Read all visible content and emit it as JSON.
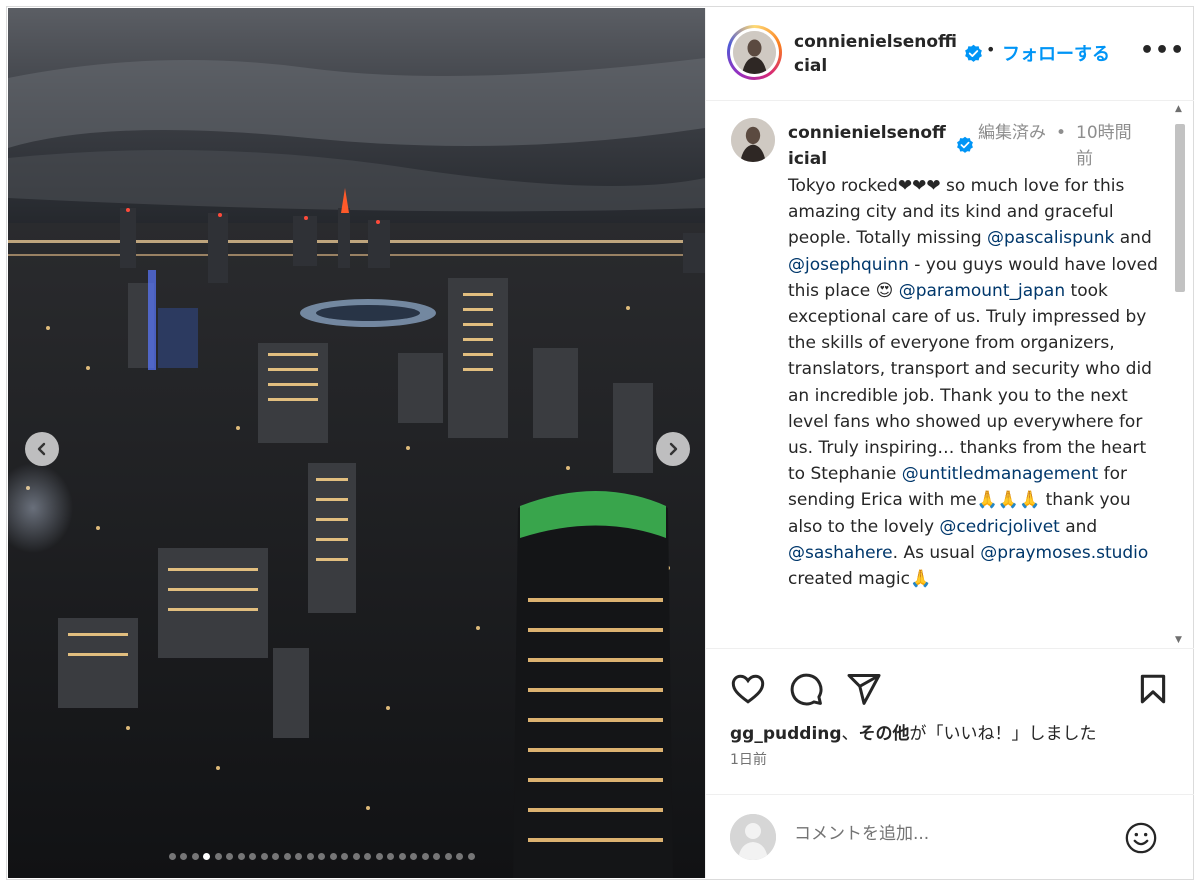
{
  "post": {
    "username": "connienielsenofficial",
    "follow_sep": "•",
    "follow_label": "フォローする",
    "more_label": "•••"
  },
  "caption": {
    "username": "connienielsenofficial",
    "edited": "編集済み",
    "dot": "•",
    "time": "10時間前",
    "segments": [
      {
        "t": "text",
        "v": "Tokyo rocked❤︎❤︎❤︎ so much love for this amazing city and its kind and graceful people. Totally missing "
      },
      {
        "t": "mention",
        "v": "@pascalispunk"
      },
      {
        "t": "text",
        "v": " and "
      },
      {
        "t": "mention",
        "v": "@josephquinn"
      },
      {
        "t": "text",
        "v": " - you guys would have loved this place 😍 "
      },
      {
        "t": "mention",
        "v": "@paramount_japan"
      },
      {
        "t": "text",
        "v": " took exceptional care of us. Truly impressed by the skills of everyone from organizers, translators, transport and security who did an incredible job. Thank you to the next level fans who showed up everywhere for us. Truly inspiring… thanks from the heart to Stephanie "
      },
      {
        "t": "mention",
        "v": "@untitledmanagement"
      },
      {
        "t": "text",
        "v": " for sending Erica with me🙏🙏🙏 thank you also to the lovely "
      },
      {
        "t": "mention",
        "v": "@cedricjolivet"
      },
      {
        "t": "text",
        "v": " and "
      },
      {
        "t": "mention",
        "v": "@sashahere"
      },
      {
        "t": "text",
        "v": ". As usual "
      },
      {
        "t": "mention",
        "v": "@praymoses.studio"
      },
      {
        "t": "text",
        "v": " created magic🙏"
      }
    ]
  },
  "likes": {
    "user": "gg_pudding",
    "sep": "、",
    "others": "その他",
    "suffix": "が「いいね！」しました"
  },
  "posted_ago": "1日前",
  "comment": {
    "placeholder": "コメントを追加..."
  },
  "carousel": {
    "total": 27,
    "current": 4
  },
  "icons": {
    "prev": "chevron-left-icon",
    "next": "chevron-right-icon",
    "like": "heart-icon",
    "comment": "comment-bubble-icon",
    "share": "paper-plane-icon",
    "save": "bookmark-icon",
    "emoji": "smiley-icon",
    "verified": "verified-badge-icon"
  },
  "colors": {
    "follow": "#0095f6",
    "verified": "#0095f6",
    "mention": "#00376b"
  }
}
